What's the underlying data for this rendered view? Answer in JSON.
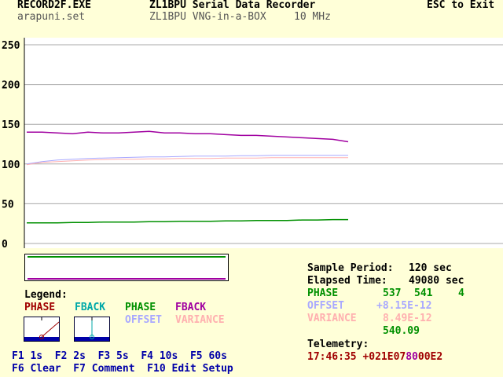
{
  "header": {
    "program": "RECORD2F.EXE",
    "title": "ZL1BPU Serial Data Recorder",
    "exit_hint": "ESC to Exit",
    "setup_file": "arapuni.set",
    "subtitle": "ZL1BPU VNG-in-a-BOX",
    "frequency": "10 MHz"
  },
  "legend": {
    "title": "Legend:",
    "meter1": "PHASE",
    "meter2": "FBACK",
    "trace_phase": "PHASE",
    "trace_fback": "FBACK",
    "trace_offset": "OFFSET",
    "trace_variance": "VARIANCE"
  },
  "status": {
    "sample_label": "Sample Period:",
    "sample_value": "120 sec",
    "elapsed_label": "Elapsed Time:",
    "elapsed_value": "49080 sec",
    "phase_label": "PHASE",
    "phase_v1": "537",
    "phase_v2": "541",
    "phase_v3": "4",
    "offset_label": "OFFSET",
    "offset_value": "+8.15E-12",
    "variance_label": "VARIANCE",
    "variance_value": "8.49E-12",
    "avg_value": "540.09",
    "telemetry_label": "Telemetry:",
    "telemetry_a": "17:46:35 +021E07",
    "telemetry_b": "80",
    "telemetry_c": "00E2"
  },
  "keys": {
    "row1": "F1 1s  F2 2s  F3 5s  F4 10s  F5 60s",
    "row2": "F6 Clear  F7 Comment  F10 Edit Setup"
  },
  "colors": {
    "phase": "#009000",
    "fback": "#a000a0",
    "offset": "#a8a8ff",
    "variance": "#ffb0b0",
    "meter_phase": "#a00000",
    "meter_fback": "#00a8a8"
  },
  "chart_data": {
    "type": "line",
    "ylim": [
      0,
      250
    ],
    "yticks": [
      "250",
      "200",
      "150",
      "100",
      "50",
      "0"
    ],
    "series": [
      {
        "name": "FBACK",
        "values": [
          140,
          140,
          139,
          138,
          140,
          139,
          139,
          140,
          141,
          139,
          139,
          138,
          138,
          137,
          136,
          136,
          135,
          134,
          133,
          132,
          131,
          128
        ]
      },
      {
        "name": "OFFSET",
        "values": [
          100,
          103,
          105,
          106,
          107,
          107.5,
          108,
          108.5,
          109,
          109,
          109.5,
          110,
          110,
          110,
          110.5,
          110.5,
          111,
          111,
          111,
          111,
          111,
          111
        ]
      },
      {
        "name": "VARIANCE",
        "values": [
          99,
          102,
          103,
          104,
          105,
          105.5,
          106,
          106,
          106.5,
          106.5,
          107,
          107,
          107,
          107.5,
          107.5,
          107.5,
          108,
          108,
          108,
          108,
          108,
          108
        ]
      },
      {
        "name": "PHASE",
        "values": [
          26,
          26,
          26,
          26.5,
          26.5,
          27,
          27,
          27,
          27.5,
          27.5,
          28,
          28,
          28,
          28.5,
          28.5,
          29,
          29,
          29,
          29.5,
          29.5,
          30,
          30
        ]
      }
    ]
  }
}
